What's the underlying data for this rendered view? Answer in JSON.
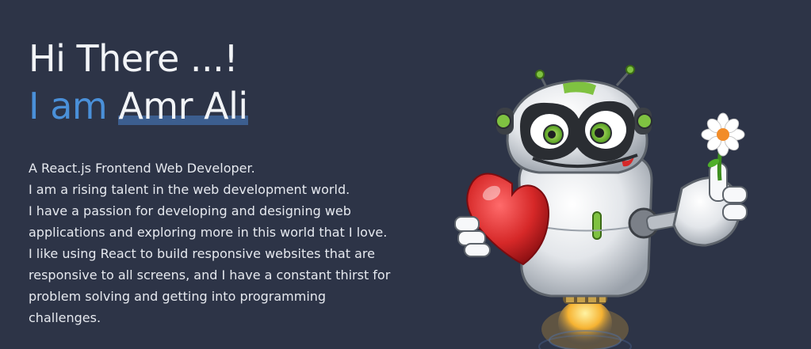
{
  "hero": {
    "greeting": "Hi There ...!",
    "intro_prefix": "I am",
    "name": "Amr Ali",
    "description_lines": [
      "A React.js Frontend Web Developer.",
      "I am a rising talent in the web development world.",
      "I have a passion for developing and designing web",
      "applications and exploring more in this world that I love.",
      "I like using React to build responsive websites that are",
      "responsive to all screens, and I have a constant thirst for",
      "problem solving and getting into programming",
      "challenges."
    ]
  },
  "colors": {
    "background": "#2d3447",
    "accent": "#4a90d9",
    "text": "#f2f4f7",
    "underline": "#3c5e8f"
  },
  "illustration": {
    "icon": "robot-with-heart-and-flower-icon"
  }
}
